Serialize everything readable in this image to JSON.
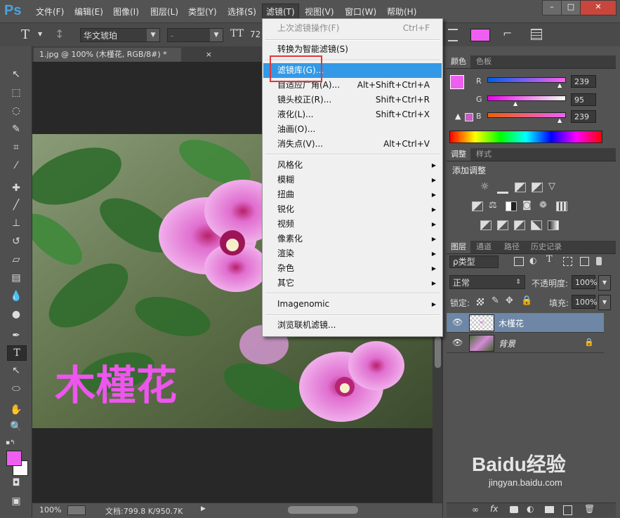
{
  "app": {
    "logo": "Ps"
  },
  "menubar": {
    "items": [
      "文件(F)",
      "编辑(E)",
      "图像(I)",
      "图层(L)",
      "类型(Y)",
      "选择(S)",
      "滤镜(T)",
      "视图(V)",
      "窗口(W)",
      "帮助(H)"
    ],
    "active": "滤镜(T)"
  },
  "window_controls": {
    "minimize": "–",
    "restore": "□",
    "close": "✕"
  },
  "options_bar": {
    "tool_glyph": "T",
    "font_family": "华文琥珀",
    "font_style": "-",
    "font_size_icon": "TT",
    "font_size": "72"
  },
  "document": {
    "tab_title": "1.jpg @ 100% (木槿花, RGB/8#) *",
    "tab_close": "×",
    "overlay_text": "木槿花",
    "overlay_color": "#ee55ee",
    "zoom": "100%",
    "doc_size": "文档:799.8 K/950.7K"
  },
  "filter_menu": {
    "items": [
      {
        "label": "上次滤镜操作(F)",
        "shortcut": "Ctrl+F",
        "disabled": true
      },
      {
        "label": "转换为智能滤镜(S)",
        "shortcut": ""
      },
      {
        "label": "滤镜库(G)...",
        "shortcut": "",
        "highlighted": true
      },
      {
        "label": "自适应广角(A)...",
        "shortcut": "Alt+Shift+Ctrl+A"
      },
      {
        "label": "镜头校正(R)...",
        "shortcut": "Shift+Ctrl+R"
      },
      {
        "label": "液化(L)...",
        "shortcut": "Shift+Ctrl+X"
      },
      {
        "label": "油画(O)...",
        "shortcut": ""
      },
      {
        "label": "消失点(V)...",
        "shortcut": "Alt+Ctrl+V"
      },
      {
        "label": "风格化",
        "submenu": true
      },
      {
        "label": "模糊",
        "submenu": true
      },
      {
        "label": "扭曲",
        "submenu": true
      },
      {
        "label": "锐化",
        "submenu": true
      },
      {
        "label": "视频",
        "submenu": true
      },
      {
        "label": "像素化",
        "submenu": true
      },
      {
        "label": "渲染",
        "submenu": true
      },
      {
        "label": "杂色",
        "submenu": true
      },
      {
        "label": "其它",
        "submenu": true
      },
      {
        "label": "Imagenomic",
        "submenu": true
      },
      {
        "label": "浏览联机滤镜...",
        "shortcut": ""
      }
    ]
  },
  "color_panel": {
    "tabs": [
      "颜色",
      "色板"
    ],
    "r_label": "R",
    "g_label": "G",
    "b_label": "B",
    "r": "239",
    "g": "95",
    "b": "239",
    "foreground": "#ef5fef"
  },
  "adjustments_panel": {
    "tabs": [
      "调整",
      "样式"
    ],
    "title": "添加调整"
  },
  "layers_panel": {
    "tabs": [
      "图层",
      "通道",
      "路径",
      "历史记录"
    ],
    "filter_kind": "ρ类型",
    "blend_mode": "正常",
    "opacity_label": "不透明度:",
    "opacity": "100%",
    "lock_label": "锁定:",
    "fill_label": "填充:",
    "fill": "100%",
    "layers": [
      {
        "name": "木槿花",
        "selected": true
      },
      {
        "name": "背景",
        "locked": true
      }
    ]
  },
  "watermark": {
    "text": "Baidu经验",
    "sub": "jingyan.baidu.com"
  }
}
